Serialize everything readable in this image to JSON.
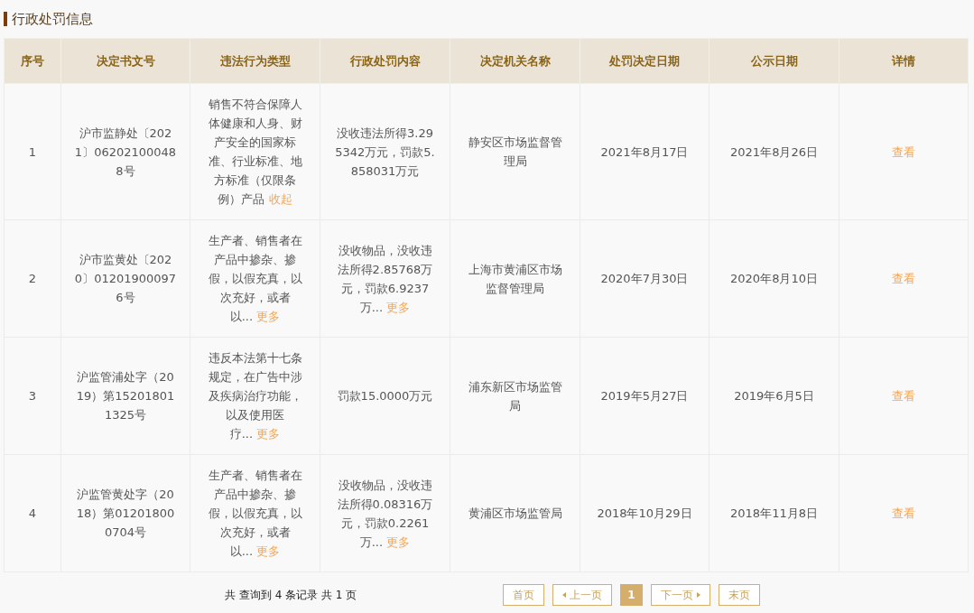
{
  "section_title": "行政处罚信息",
  "table": {
    "columns": [
      "序号",
      "决定书文号",
      "违法行为类型",
      "行政处罚内容",
      "决定机关名称",
      "处罚决定日期",
      "公示日期",
      "详情"
    ],
    "rows": [
      {
        "number": "1",
        "doc_no": "沪市监静处〔2021〕062021000488号",
        "violation": "销售不符合保障人体健康和人身、财产安全的国家标准、行业标准、地方标准（仅限条例）产品",
        "violation_link": "收起",
        "penalty": "没收违法所得3.295342万元，罚款5.858031万元",
        "authority": "静安区市场监督管理局",
        "decision_date": "2021年8月17日",
        "publish_date": "2021年8月26日",
        "detail": "查看"
      },
      {
        "number": "2",
        "doc_no": "沪市监黄处〔2020〕012019000976号",
        "violation": "生产者、销售者在产品中掺杂、掺假，以假充真，以次充好，或者以...",
        "violation_link": "更多",
        "penalty": "没收物品，没收违法所得2.85768万元，罚款6.9237万...",
        "penalty_link": "更多",
        "authority": "上海市黄浦区市场监督管理局",
        "decision_date": "2020年7月30日",
        "publish_date": "2020年8月10日",
        "detail": "查看"
      },
      {
        "number": "3",
        "doc_no": "沪监管浦处字（2019）第152018011325号",
        "violation": "违反本法第十七条规定，在广告中涉及疾病治疗功能，以及使用医疗...",
        "violation_link": "更多",
        "penalty": "罚款15.0000万元",
        "authority": "浦东新区市场监管局",
        "decision_date": "2019年5月27日",
        "publish_date": "2019年6月5日",
        "detail": "查看"
      },
      {
        "number": "4",
        "doc_no": "沪监管黄处字（2018）第012018000704号",
        "violation": "生产者、销售者在产品中掺杂、掺假，以假充真，以次充好，或者以...",
        "violation_link": "更多",
        "penalty": "没收物品，没收违法所得0.08316万元，罚款0.2261万...",
        "penalty_link": "更多",
        "authority": "黄浦区市场监管局",
        "decision_date": "2018年10月29日",
        "publish_date": "2018年11月8日",
        "detail": "查看"
      }
    ]
  },
  "pagination": {
    "summary": "共 查询到 4 条记录 共 1 页",
    "buttons": [
      {
        "kind": "first",
        "label": "首页"
      },
      {
        "kind": "prev",
        "label": "上一页"
      },
      {
        "kind": "page",
        "label": "1",
        "selected": true
      },
      {
        "kind": "next",
        "label": "下一页"
      },
      {
        "kind": "last",
        "label": "末页"
      }
    ]
  }
}
